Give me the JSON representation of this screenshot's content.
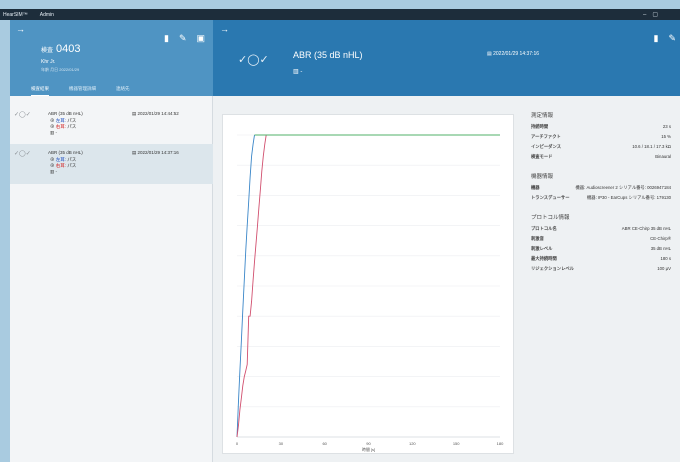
{
  "titlebar": {
    "app": "HearSIM™",
    "user": "Admin"
  },
  "patient": {
    "id_label": "検査",
    "id": "0403",
    "name": "Khr Jr.",
    "detail": "年齢 月日 2022/01/29"
  },
  "left_tabs": [
    {
      "label": "検査結果",
      "active": true
    },
    {
      "label": "機器管理詳細",
      "active": false
    },
    {
      "label": "連絡先",
      "active": false
    }
  ],
  "records": [
    {
      "title": "ABR (35 dB nHL)",
      "date": "2022/01/29 14:44:52",
      "left_label": "左耳:",
      "left_value": "パス",
      "right_label": "右耳:",
      "right_value": "パス",
      "extra": "-",
      "selected": false
    },
    {
      "title": "ABR (35 dB nHL)",
      "date": "2022/01/29 14:37:16",
      "left_label": "左耳:",
      "left_value": "パス",
      "right_label": "右耳:",
      "right_value": "パス",
      "extra": "-",
      "selected": true
    }
  ],
  "detail_header": {
    "title": "ABR (35 dB nHL)",
    "sub": "-",
    "date": "2022/01/29 14:37:16"
  },
  "chart_data": {
    "type": "line",
    "xlabel": "時間 [s]",
    "xlim": [
      0,
      180
    ],
    "ylim": [
      0,
      100
    ],
    "xticks": [
      0,
      30,
      60,
      90,
      120,
      150,
      180
    ],
    "series": [
      {
        "color": "#3a86c8",
        "x": [
          0,
          1,
          2,
          3,
          4,
          5,
          6,
          7,
          8,
          9,
          10,
          11,
          12
        ],
        "y": [
          0,
          12,
          22,
          32,
          42,
          52,
          62,
          70,
          78,
          86,
          93,
          97,
          100
        ]
      },
      {
        "color": "#d14f6e",
        "x": [
          0,
          1,
          2,
          3,
          4,
          5,
          6,
          7,
          8,
          9,
          10,
          11,
          12,
          13,
          14,
          15,
          16,
          17,
          18,
          19,
          20,
          21
        ],
        "y": [
          0,
          4,
          9,
          13,
          17,
          20,
          22,
          24,
          40,
          40,
          45,
          52,
          58,
          64,
          70,
          76,
          82,
          88,
          93,
          97,
          100,
          100
        ]
      },
      {
        "color": "#52b06a",
        "x": [
          12,
          180
        ],
        "y": [
          100,
          100
        ]
      }
    ]
  },
  "info": {
    "measurement_title": "測定情報",
    "measurement": [
      {
        "k": "持続時間",
        "v": "23 s"
      },
      {
        "k": "アーチファクト",
        "v": "15 %"
      },
      {
        "k": "インピーダンス",
        "v": "10.6 / 18.1 / 17.3 kΩ"
      },
      {
        "k": "検査モード",
        "v": "Binaural"
      }
    ],
    "device_title": "機器情報",
    "device": [
      {
        "k": "機器",
        "v": "機器: Audioscreener 2  シリアル番号: 0026947184"
      },
      {
        "k": "トランスデューサー",
        "v": "機器: IP30 - EarCups  シリアル番号: 179130"
      }
    ],
    "protocol_title": "プロトコル情報",
    "protocol": [
      {
        "k": "プロトコル名",
        "v": "ABR CE-Chirp 35 dB nHL"
      },
      {
        "k": "刺激音",
        "v": "CE-Chirp®"
      },
      {
        "k": "刺激レベル",
        "v": "35 dB nHL"
      },
      {
        "k": "最大持続時間",
        "v": "180 s"
      },
      {
        "k": "リジェクションレベル",
        "v": "100 µV"
      }
    ]
  }
}
